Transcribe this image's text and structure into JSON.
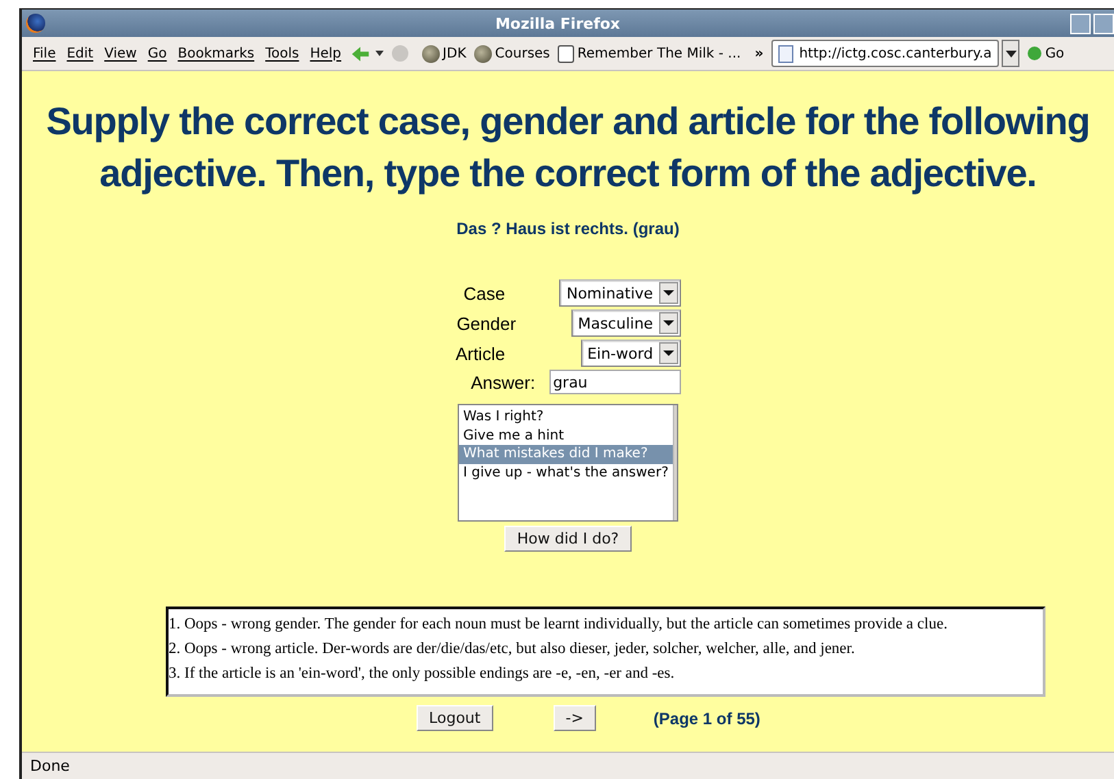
{
  "window": {
    "title": "Mozilla Firefox"
  },
  "menu": [
    "File",
    "Edit",
    "View",
    "Go",
    "Bookmarks",
    "Tools",
    "Help"
  ],
  "bookmarks": [
    "JDK",
    "Courses",
    "Remember The Milk - ..."
  ],
  "overflow": "»",
  "address": "http://ictg.cosc.canterbury.a",
  "go": "Go",
  "heading": "Supply the correct case, gender and article for the following adjective. Then, type the correct form of the adjective.",
  "question": "Das ? Haus ist rechts. (grau)",
  "fields": [
    {
      "kind": "select",
      "label": "Case",
      "value": "Nominative"
    },
    {
      "kind": "select",
      "label": "Gender",
      "value": "Masculine"
    },
    {
      "kind": "select",
      "label": "Article",
      "value": "Ein-word"
    },
    {
      "kind": "text",
      "label": "Answer:",
      "value": "grau"
    }
  ],
  "options": [
    {
      "label": "Was I right?",
      "selected": false
    },
    {
      "label": "Give me a hint",
      "selected": false
    },
    {
      "label": "What mistakes did I make?",
      "selected": true
    },
    {
      "label": "I give up - what's the answer?",
      "selected": false
    }
  ],
  "check_button": "How did I do?",
  "feedback": [
    "1. Oops - wrong gender. The gender for each noun must be learnt individually, but the article can sometimes provide a clue.",
    "2. Oops - wrong article. Der-words are der/die/das/etc, but also dieser, jeder, solcher, welcher, alle, and jener.",
    "3. If the article is an 'ein-word', the only possible endings are -e, -en, -er and -es."
  ],
  "logout": "Logout",
  "next": "->",
  "page": "(Page 1 of 55)",
  "status_bar": "Done"
}
